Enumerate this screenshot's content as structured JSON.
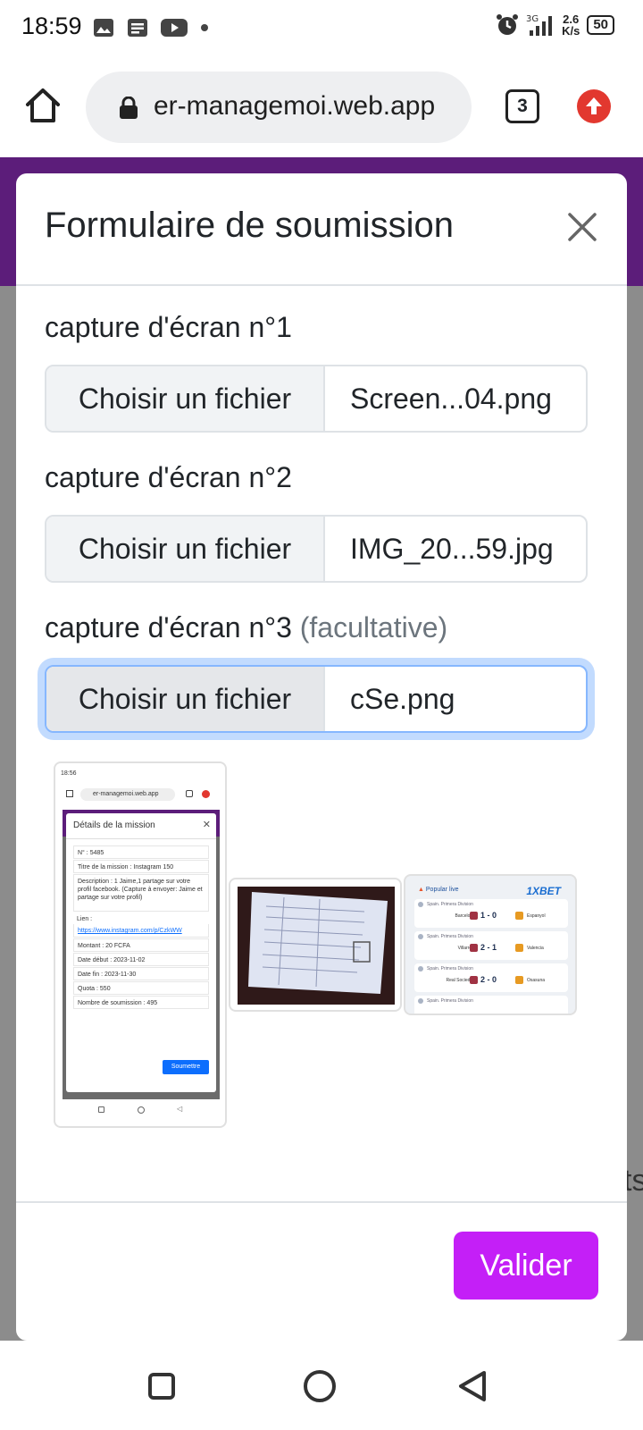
{
  "status_bar": {
    "time": "18:59",
    "speed_value": "2.6",
    "speed_unit": "K/s",
    "battery": "50"
  },
  "browser": {
    "url": "er-managemoi.web.app",
    "tab_count": "3"
  },
  "modal": {
    "title": "Formulaire de soumission",
    "fields": [
      {
        "label": "capture d'écran n°1",
        "suffix": "",
        "button": "Choisir un fichier",
        "filename": "Screen...04.png"
      },
      {
        "label": "capture d'écran n°2",
        "suffix": "",
        "button": "Choisir un fichier",
        "filename": "IMG_20...59.jpg"
      },
      {
        "label": "capture d'écran n°3",
        "suffix": "(facultative)",
        "button": "Choisir un fichier",
        "filename": "cSe.png"
      }
    ],
    "submit_label": "Valider"
  },
  "background_text": "ts",
  "preview_1": {
    "time": "18:56",
    "url": "er-managemoi.web.app",
    "title": "Détails de la mission",
    "rows": [
      "N° : 5485",
      "Titre de la mission : Instagram 150",
      "Description : 1 Jaime,1 partage sur votre profil facebook. (Capture à envoyer: Jaime et partage sur votre profil)",
      "Lien :",
      "https://www.instagram.com/p/CzkWW",
      "Montant : 20 FCFA",
      "Date début : 2023-11-02",
      "Date fin : 2023-11-30",
      "Quota : 550",
      "Nombre de soumission : 495"
    ],
    "button": "Soumettre"
  },
  "preview_3": {
    "header": "Popular live",
    "brand": "1XBET",
    "matches": [
      {
        "league": "Spain. Primera Division",
        "home": "Barcelona",
        "score": "1 - 0",
        "away": "Espanyol"
      },
      {
        "league": "Spain. Primera Division",
        "home": "Villarreal",
        "score": "2 - 1",
        "away": "Valencia"
      },
      {
        "league": "Spain. Primera Division",
        "home": "Real Sociedad",
        "score": "2 - 0",
        "away": "Osasuna"
      },
      {
        "league": "Spain. Primera Division",
        "home": "",
        "score": "",
        "away": ""
      }
    ]
  }
}
